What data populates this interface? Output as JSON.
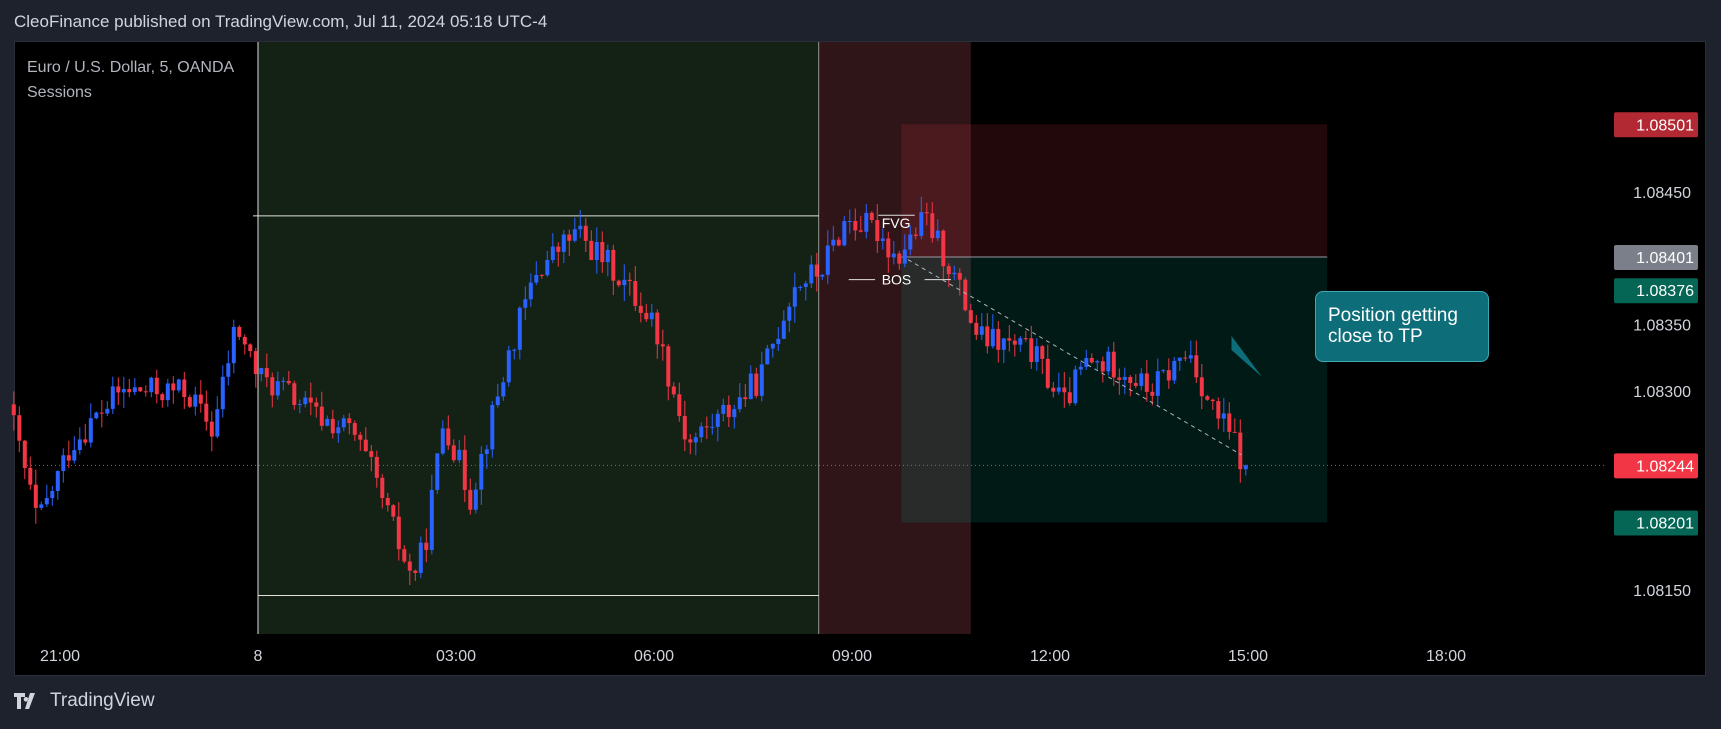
{
  "header": {
    "published": "CleoFinance published on TradingView.com, Jul 11, 2024 05:18 UTC-4"
  },
  "legend": {
    "symbol": "Euro / U.S. Dollar, 5, OANDA",
    "indicator": "Sessions"
  },
  "footer": {
    "brand": "TradingView"
  },
  "annotations": {
    "fvg": "FVG",
    "bos": "BOS",
    "callout": "Position getting close to TP"
  },
  "colors": {
    "bull": "#2962ff",
    "bear": "#f23645",
    "background": "#000000",
    "stop_zone": "#f23645",
    "target_zone": "#089981",
    "callout": "#0d6e7a",
    "session_asia": "#1b2e1e",
    "session_london": "#3b1a1e"
  },
  "chart_data": {
    "type": "candlestick",
    "symbol": "EURUSD",
    "interval": "5",
    "ylim": [
      1.0812,
      1.0856
    ],
    "y_ticks": [
      "1.08450",
      "1.08350",
      "1.08300",
      "1.08150"
    ],
    "x_ticks": [
      "21:00",
      "8",
      "03:00",
      "06:00",
      "09:00",
      "12:00",
      "15:00",
      "18:00"
    ],
    "x_tick_hours": [
      -3,
      0,
      3,
      6,
      9,
      12,
      15,
      18
    ],
    "x_range_hours": [
      -3.7,
      21.4
    ],
    "price_labels": [
      {
        "value": "1.08501",
        "price": 1.08501,
        "color": "#b22833"
      },
      {
        "value": "1.08401",
        "price": 1.08401,
        "color": "#7b7f8a"
      },
      {
        "value": "1.08376",
        "price": 1.08376,
        "color": "#056656"
      },
      {
        "value": "1.08244",
        "price": 1.08244,
        "color": "#f23645"
      },
      {
        "value": "1.08201",
        "price": 1.08201,
        "color": "#056656"
      }
    ],
    "last_price": 1.08244,
    "session_boxes": [
      {
        "name": "asia",
        "start_h": 0.0,
        "end_h": 8.5,
        "high": 1.08432,
        "low": 1.08146
      },
      {
        "name": "london",
        "start_h": 8.5,
        "end_h": 10.8
      }
    ],
    "position": {
      "type": "short",
      "start_h": 9.75,
      "end_h": 16.2,
      "entry": 1.08401,
      "stop": 1.08501,
      "target": 1.08201
    },
    "fvg_level": 1.08428,
    "bos_level": 1.08384,
    "key_points": [
      [
        -3.7,
        1.0829
      ],
      [
        -3.25,
        1.082
      ],
      [
        -2.75,
        1.0826
      ],
      [
        -2.0,
        1.083
      ],
      [
        -1.0,
        1.083
      ],
      [
        -0.6,
        1.0827
      ],
      [
        -0.25,
        1.0835
      ],
      [
        0.1,
        1.0831
      ],
      [
        0.5,
        1.083
      ],
      [
        1.0,
        1.0828
      ],
      [
        1.5,
        1.0827
      ],
      [
        1.8,
        1.0824
      ],
      [
        2.4,
        1.0816
      ],
      [
        2.6,
        1.0818
      ],
      [
        2.9,
        1.0828
      ],
      [
        3.3,
        1.0822
      ],
      [
        3.9,
        1.0833
      ],
      [
        4.3,
        1.0839
      ],
      [
        4.9,
        1.0842
      ],
      [
        5.5,
        1.0839
      ],
      [
        6.1,
        1.0835
      ],
      [
        6.6,
        1.0826
      ],
      [
        7.3,
        1.0829
      ],
      [
        7.7,
        1.0831
      ],
      [
        8.2,
        1.0838
      ],
      [
        8.6,
        1.0839
      ],
      [
        9.0,
        1.0843
      ],
      [
        9.5,
        1.0842
      ],
      [
        9.75,
        1.084
      ],
      [
        10.2,
        1.0843
      ],
      [
        10.6,
        1.0839
      ],
      [
        11.0,
        1.0834
      ],
      [
        11.8,
        1.0833
      ],
      [
        12.3,
        1.0829
      ],
      [
        12.6,
        1.0832
      ],
      [
        13.1,
        1.0832
      ],
      [
        13.6,
        1.083
      ],
      [
        14.2,
        1.0833
      ],
      [
        14.5,
        1.0829
      ],
      [
        14.9,
        1.0826
      ],
      [
        15.0,
        1.08244
      ]
    ]
  }
}
